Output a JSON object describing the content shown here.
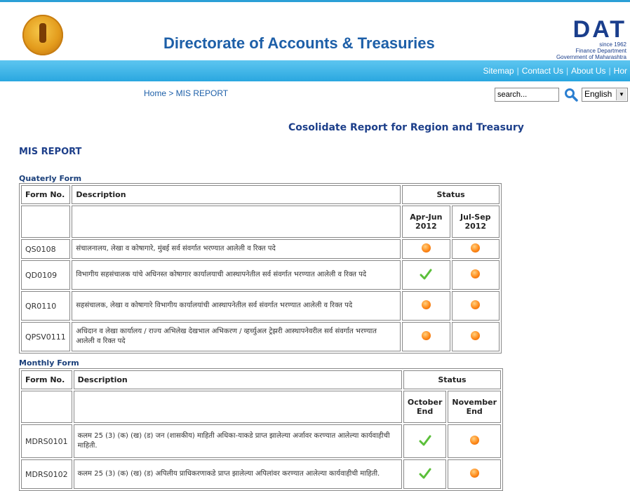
{
  "header": {
    "site_title": "Directorate of Accounts & Treasuries",
    "logo_letters": "DAT",
    "logo_since": "since 1962",
    "logo_dept": "Finance Department",
    "logo_gov": "Government of Maharashtra"
  },
  "nav": {
    "items": [
      "Sitemap",
      "Contact Us",
      "About Us",
      "Hor"
    ]
  },
  "subbar": {
    "breadcrumb": "Home > MIS REPORT",
    "search_value": "search...",
    "language": "English"
  },
  "page": {
    "report_title": "Cosolidate Report for Region and Treasury",
    "mis_title": "MIS REPORT"
  },
  "quarterly": {
    "section_label": "Quaterly Form",
    "col_form": "Form No.",
    "col_desc": "Description",
    "col_status": "Status",
    "periods": [
      "Apr-Jun 2012",
      "Jul-Sep 2012"
    ],
    "rows": [
      {
        "code": "QS0108",
        "desc": "संचालनालय, लेखा व कोषागारे, मुंबई सर्व संवर्गात भरण्यात आलेली व रिक्त पदे",
        "status": [
          "pending",
          "pending"
        ]
      },
      {
        "code": "QD0109",
        "desc": "विभागीय सहसंचालक यांचे अधिनस्त कोषागार कार्यालयाची आस्थापनेतील सर्व संवर्गात भरण्यात आलेली व रिक्त पदे",
        "status": [
          "done",
          "pending"
        ]
      },
      {
        "code": "QR0110",
        "desc": "सहसंचालक, लेखा व कोषागारे विभागीय कार्यालयांची आस्थापनेतील सर्व संवर्गात भरण्यात आलेली व रिक्त पदे",
        "status": [
          "pending",
          "pending"
        ]
      },
      {
        "code": "QPSV0111",
        "desc": "अधिदान व लेखा कार्यालय / राज्य अभिलेख देखभाल अभिकरण / व्हर्च्युअल ट्रेझरी आस्थापनेवरील सर्व संवर्गात भरण्यात आलेली व रिक्त पदे",
        "status": [
          "pending",
          "pending"
        ]
      }
    ]
  },
  "monthly": {
    "section_label": "Monthly Form",
    "col_form": "Form No.",
    "col_desc": "Description",
    "col_status": "Status",
    "periods": [
      "October End",
      "November End"
    ],
    "rows": [
      {
        "code": "MDRS0101",
        "desc": "कलम 25 (3) (क) (ख) (ड) जन (शासकीय) माहिती अधिका-याकडे प्राप्त झालेल्या अर्जावर करण्यात आलेल्या कार्यवाहीची माहिती.",
        "status": [
          "done",
          "pending"
        ]
      },
      {
        "code": "MDRS0102",
        "desc": "कलम 25 (3) (क) (ख) (ड) अपिलीय प्राधिकरणाकडे प्राप्त झालेल्या अपिलांवर करण्यात आलेल्या कार्यवाहीची माहिती.",
        "status": [
          "done",
          "pending"
        ]
      }
    ]
  },
  "colors": {
    "brand_blue": "#1d5fa8",
    "nav_blue": "#2aa7e0",
    "pending_orange": "#ff8a1a",
    "done_green": "#5bbf3a"
  },
  "icons": {
    "pending": "orange-dot-icon",
    "done": "green-check-icon",
    "search": "search-icon"
  }
}
